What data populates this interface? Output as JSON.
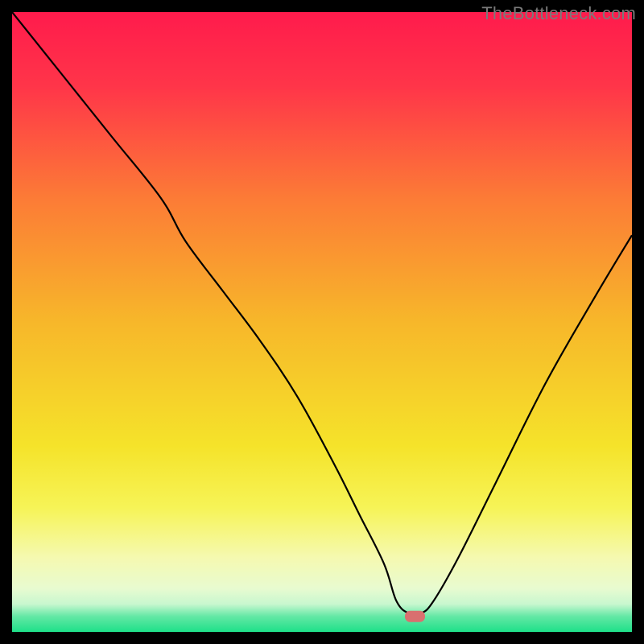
{
  "watermark": "TheBottleneck.com",
  "colors": {
    "background": "#000000",
    "curve": "#000000",
    "marker_fill": "#d9706f",
    "marker_outline": "#d9706f",
    "gradient_stops": [
      {
        "offset": 0.0,
        "color": "#ff1b4c"
      },
      {
        "offset": 0.12,
        "color": "#ff3549"
      },
      {
        "offset": 0.3,
        "color": "#fc7b36"
      },
      {
        "offset": 0.5,
        "color": "#f7b72a"
      },
      {
        "offset": 0.7,
        "color": "#f5e32a"
      },
      {
        "offset": 0.8,
        "color": "#f6f457"
      },
      {
        "offset": 0.88,
        "color": "#f5f9b0"
      },
      {
        "offset": 0.93,
        "color": "#e8fbd0"
      },
      {
        "offset": 0.955,
        "color": "#c8f7cf"
      },
      {
        "offset": 0.975,
        "color": "#63e8a5"
      },
      {
        "offset": 1.0,
        "color": "#1ee089"
      }
    ]
  },
  "chart_data": {
    "type": "line",
    "title": "",
    "xlabel": "",
    "ylabel": "",
    "xlim": [
      0,
      100
    ],
    "ylim": [
      0,
      100
    ],
    "legend": false,
    "grid": false,
    "marker": {
      "x": 65,
      "y": 2.5,
      "shape": "rounded-rect"
    },
    "series": [
      {
        "name": "bottleneck-curve",
        "x": [
          0,
          8,
          16,
          24,
          28,
          34,
          40,
          46,
          52,
          56,
          60,
          62,
          64,
          66,
          68,
          72,
          78,
          86,
          94,
          100
        ],
        "y": [
          100,
          90,
          80,
          70,
          63,
          55,
          47,
          38,
          27,
          19,
          11,
          5,
          3,
          3,
          5,
          12,
          24,
          40,
          54,
          64
        ]
      }
    ]
  }
}
